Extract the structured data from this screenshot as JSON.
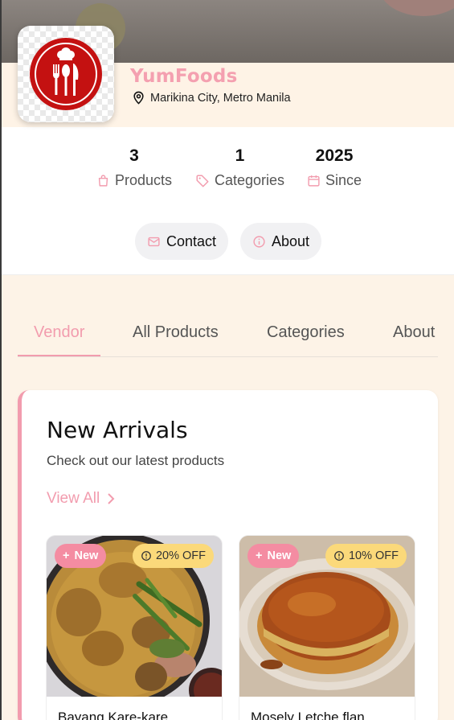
{
  "vendor": {
    "name": "YumFoods",
    "location": "Marikina City, Metro Manila"
  },
  "stats": [
    {
      "value": "3",
      "label": "Products",
      "icon": "shopping-bag-icon"
    },
    {
      "value": "1",
      "label": "Categories",
      "icon": "tag-icon"
    },
    {
      "value": "2025",
      "label": "Since",
      "icon": "calendar-icon"
    }
  ],
  "actions": {
    "contact_label": "Contact",
    "about_label": "About"
  },
  "tabs": [
    {
      "label": "Vendor",
      "active": true
    },
    {
      "label": "All Products",
      "active": false
    },
    {
      "label": "Categories",
      "active": false
    },
    {
      "label": "About",
      "active": false
    }
  ],
  "section": {
    "title": "New Arrivals",
    "subtitle": "Check out our latest products",
    "view_all": "View All"
  },
  "products": [
    {
      "name": "Bayang Kare-kare",
      "badge_new": "New",
      "discount": "20% OFF"
    },
    {
      "name": "Mosely Letche flan",
      "badge_new": "New",
      "discount": "10% OFF"
    }
  ],
  "colors": {
    "accent": "#f29cae",
    "brand_red": "#c41111",
    "discount_badge": "#fbd97a",
    "background": "#fdf3e7"
  }
}
